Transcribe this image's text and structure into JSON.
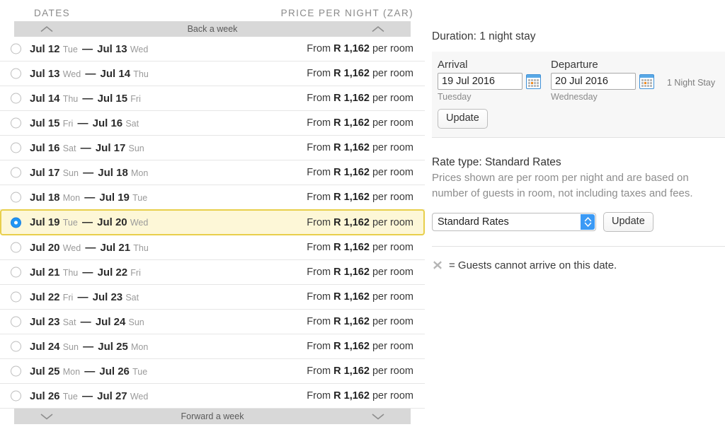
{
  "columns": {
    "dates_header": "DATES",
    "price_header": "PRICE PER NIGHT (ZAR)"
  },
  "nav": {
    "back_label": "Back a week",
    "forward_label": "Forward a week",
    "back_icon": "chevron-up-icon",
    "forward_icon": "chevron-down-icon"
  },
  "price_prefix": "From",
  "price_suffix": "per room",
  "rows": [
    {
      "start_date": "Jul 12",
      "start_dow": "Tue",
      "end_date": "Jul 13",
      "end_dow": "Wed",
      "dash": "—",
      "price": "R 1,162",
      "selected": false
    },
    {
      "start_date": "Jul 13",
      "start_dow": "Wed",
      "end_date": "Jul 14",
      "end_dow": "Thu",
      "dash": "—",
      "price": "R 1,162",
      "selected": false
    },
    {
      "start_date": "Jul 14",
      "start_dow": "Thu",
      "end_date": "Jul 15",
      "end_dow": "Fri",
      "dash": "—",
      "price": "R 1,162",
      "selected": false
    },
    {
      "start_date": "Jul 15",
      "start_dow": "Fri",
      "end_date": "Jul 16",
      "end_dow": "Sat",
      "dash": "—",
      "price": "R 1,162",
      "selected": false
    },
    {
      "start_date": "Jul 16",
      "start_dow": "Sat",
      "end_date": "Jul 17",
      "end_dow": "Sun",
      "dash": "—",
      "price": "R 1,162",
      "selected": false
    },
    {
      "start_date": "Jul 17",
      "start_dow": "Sun",
      "end_date": "Jul 18",
      "end_dow": "Mon",
      "dash": "—",
      "price": "R 1,162",
      "selected": false
    },
    {
      "start_date": "Jul 18",
      "start_dow": "Mon",
      "end_date": "Jul 19",
      "end_dow": "Tue",
      "dash": "—",
      "price": "R 1,162",
      "selected": false
    },
    {
      "start_date": "Jul 19",
      "start_dow": "Tue",
      "end_date": "Jul 20",
      "end_dow": "Wed",
      "dash": "—",
      "price": "R 1,162",
      "selected": true
    },
    {
      "start_date": "Jul 20",
      "start_dow": "Wed",
      "end_date": "Jul 21",
      "end_dow": "Thu",
      "dash": "—",
      "price": "R 1,162",
      "selected": false
    },
    {
      "start_date": "Jul 21",
      "start_dow": "Thu",
      "end_date": "Jul 22",
      "end_dow": "Fri",
      "dash": "—",
      "price": "R 1,162",
      "selected": false
    },
    {
      "start_date": "Jul 22",
      "start_dow": "Fri",
      "end_date": "Jul 23",
      "end_dow": "Sat",
      "dash": "—",
      "price": "R 1,162",
      "selected": false
    },
    {
      "start_date": "Jul 23",
      "start_dow": "Sat",
      "end_date": "Jul 24",
      "end_dow": "Sun",
      "dash": "—",
      "price": "R 1,162",
      "selected": false
    },
    {
      "start_date": "Jul 24",
      "start_dow": "Sun",
      "end_date": "Jul 25",
      "end_dow": "Mon",
      "dash": "—",
      "price": "R 1,162",
      "selected": false
    },
    {
      "start_date": "Jul 25",
      "start_dow": "Mon",
      "end_date": "Jul 26",
      "end_dow": "Tue",
      "dash": "—",
      "price": "R 1,162",
      "selected": false
    },
    {
      "start_date": "Jul 26",
      "start_dow": "Tue",
      "end_date": "Jul 27",
      "end_dow": "Wed",
      "dash": "—",
      "price": "R 1,162",
      "selected": false
    }
  ],
  "sidebar": {
    "duration": "Duration: 1 night stay",
    "arrival": {
      "label": "Arrival",
      "value": "19 Jul 2016",
      "placeholder": "dd Mmm yyyy",
      "day_of_week": "Tuesday",
      "calendar_icon": "calendar-icon"
    },
    "departure": {
      "label": "Departure",
      "value": "20 Jul 2016",
      "placeholder": "dd Mmm yyyy",
      "day_of_week": "Wednesday",
      "calendar_icon": "calendar-icon"
    },
    "nights_summary": "1 Night Stay",
    "update_dates_label": "Update",
    "rate_type_title": "Rate type: Standard Rates",
    "rate_type_description": "Prices shown are per room per night and are based on number of guests in room, not including taxes and fees.",
    "rate_select": {
      "selected": "Standard Rates",
      "options": [
        "Standard Rates"
      ],
      "arrow_icon": "select-stepper-icon"
    },
    "update_rate_label": "Update",
    "legend": {
      "icon": "x-unavailable-icon",
      "text": "= Guests cannot arrive on this date."
    }
  },
  "colors": {
    "selected_row_bg": "#fdf7d7",
    "selected_row_border": "#e8cf4b",
    "radio_selected": "#2196f3",
    "accent_blue": "#3b9af5",
    "week_bar_bg": "#d8d8d8",
    "panel_bg": "#f7f7f7"
  }
}
